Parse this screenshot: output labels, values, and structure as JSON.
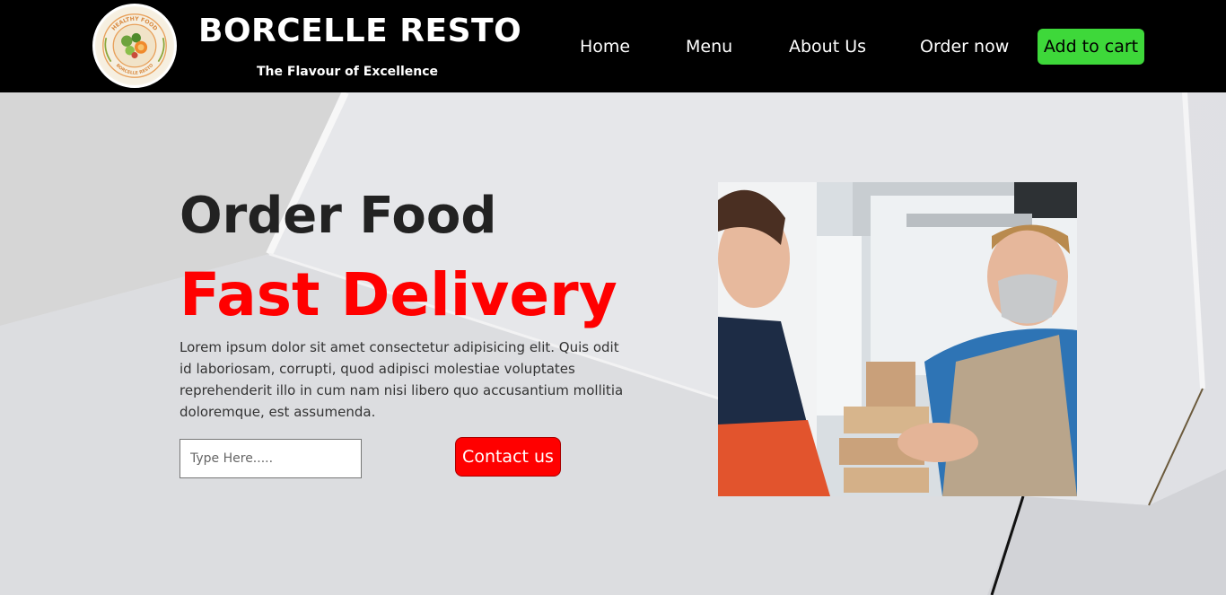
{
  "header": {
    "brand_title": "BORCELLE RESTO",
    "brand_tagline": "The Flavour of Excellence",
    "logo": {
      "top_text": "HEALTHY FOOD",
      "bottom_text": "BORCELLE RESTO"
    },
    "nav": {
      "home": "Home",
      "menu": "Menu",
      "about": "About Us",
      "order": "Order now"
    },
    "cart_button": "Add to cart"
  },
  "hero": {
    "headline": "Order Food",
    "headline_accent": "Fast Delivery",
    "description": "Lorem ipsum dolor sit amet consectetur adipisicing elit. Quis odit id laboriosam, corrupti, quod adipisci molestiae voluptates reprehenderit illo in cum nam nisi libero quo accusantium mollitia doloremque, est assumenda.",
    "search_placeholder": "Type Here.....",
    "contact_button": "Contact us"
  },
  "colors": {
    "navbar": "#000000",
    "cart_button": "#3ed83a",
    "accent_red": "#ff0000"
  },
  "icons": {
    "logo": "healthy-food-logo"
  }
}
